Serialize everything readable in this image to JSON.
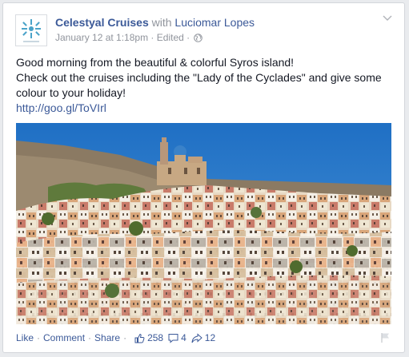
{
  "post": {
    "page_name": "Celestyal Cruises",
    "with_text": "with",
    "partner_name": "Luciomar Lopes",
    "date": "January 12 at 1:18pm",
    "edited": "Edited",
    "text_line1": "Good morning from the beautiful & colorful Syros island!",
    "text_line2": "Check out the cruises including the \"Lady of the Cyclades\" and give some colour to your holiday!",
    "link": "http://goo.gl/ToVIrl"
  },
  "footer": {
    "like": "Like",
    "comment": "Comment",
    "share": "Share",
    "likes_count": "258",
    "comments_count": "4",
    "shares_count": "12"
  },
  "icons": {
    "avatar": "celestyal-logo-icon",
    "privacy": "globe-icon",
    "menu": "chevron-down-icon",
    "likes": "thumbs-up-icon",
    "comments": "comment-icon",
    "shares": "share-arrow-icon",
    "report": "flag-icon"
  },
  "colors": {
    "link_blue": "#3b5998",
    "meta_gray": "#90949c",
    "sky": "#2b7ac8"
  }
}
